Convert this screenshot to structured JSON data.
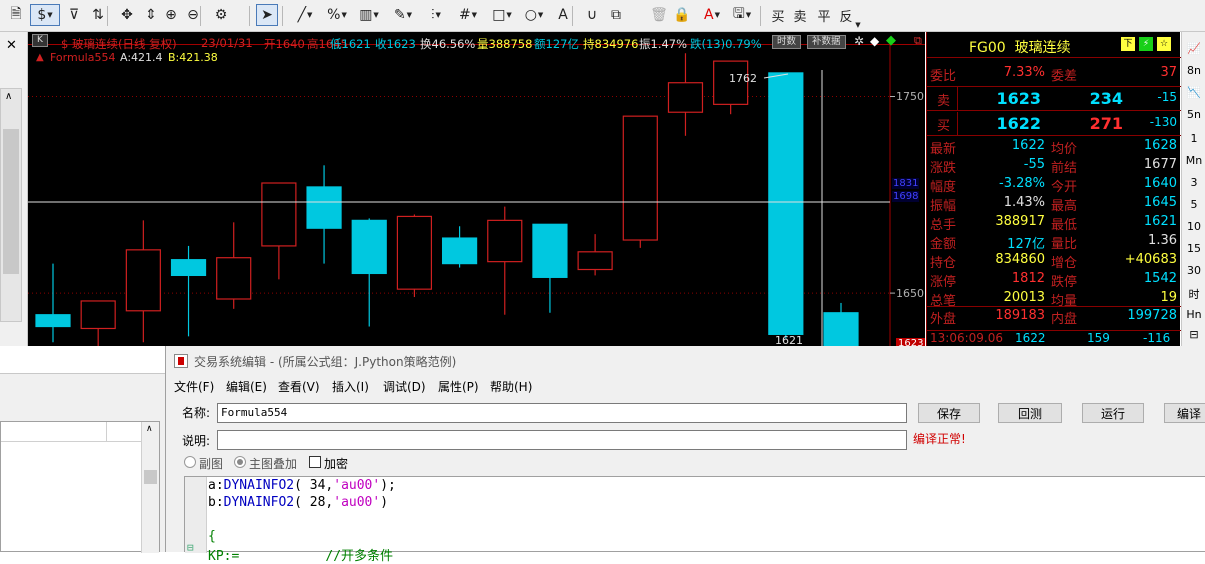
{
  "toolbar": {
    "items": [
      {
        "name": "document-icon",
        "glyph": "🗎"
      },
      {
        "name": "currency-icon",
        "glyph": "$"
      },
      {
        "name": "filter-icon",
        "glyph": "⊽"
      },
      {
        "name": "refresh-icon",
        "glyph": "⇅"
      },
      {
        "name": "move-icon",
        "glyph": "✥"
      },
      {
        "name": "vertical-cursor-icon",
        "glyph": "⇕"
      },
      {
        "name": "zoom-in-icon",
        "glyph": "⊕"
      },
      {
        "name": "zoom-out-icon",
        "glyph": "⊖"
      },
      {
        "name": "settings-icon",
        "glyph": "⚙"
      },
      {
        "name": "pointer-icon",
        "glyph": "➤"
      },
      {
        "name": "line-draw-icon",
        "glyph": "╱"
      },
      {
        "name": "percent-icon",
        "glyph": "%"
      },
      {
        "name": "ruler-icon",
        "glyph": "▥"
      },
      {
        "name": "pen-icon",
        "glyph": "✎"
      },
      {
        "name": "bars-icon",
        "glyph": "⫶"
      },
      {
        "name": "grid-icon",
        "glyph": "#"
      },
      {
        "name": "rectangle-icon",
        "glyph": "□"
      },
      {
        "name": "ellipse-icon",
        "glyph": "○"
      },
      {
        "name": "text-icon",
        "glyph": "A"
      },
      {
        "name": "magnet-icon",
        "glyph": "∪"
      },
      {
        "name": "copy-icon",
        "glyph": "⧉"
      },
      {
        "name": "delete-icon",
        "glyph": "🗑"
      },
      {
        "name": "lock-icon",
        "glyph": "🔒"
      },
      {
        "name": "font-color-icon",
        "glyph": "A"
      },
      {
        "name": "save-icon",
        "glyph": "🖫"
      }
    ],
    "trade_buttons": [
      "买",
      "卖",
      "平",
      "反"
    ]
  },
  "chart": {
    "header": {
      "title": "$ 玻璃连续(日线 复权)",
      "date": "23/01/31",
      "open": "开1640",
      "high": "高1645",
      "low": "低1621",
      "close": "收1623",
      "turnover": "换46.56%",
      "volume": "量388758",
      "amount": "额127亿",
      "oi": "持834976",
      "amplitude": "振1.47%",
      "change": "跌(13)0.79%",
      "btn_period": "时数",
      "btn_fill": "补数据"
    },
    "formula_line": {
      "name": "Formula554",
      "a": "A:421.4",
      "b": "B:421.38"
    },
    "price_labels": {
      "p1750": "1750",
      "p1650": "1650",
      "cross_hi": "1831",
      "cross_lo": "1698",
      "bottom": "1623",
      "high_marker": "1762",
      "low_marker": "1621"
    },
    "colors": {
      "bg": "#000000",
      "up": "#d02020",
      "down": "#00c8e0",
      "grid": "#8b0000",
      "axis": "#b0b0b0"
    }
  },
  "chart_data": {
    "type": "candlestick",
    "ylim": [
      1617,
      1780
    ],
    "ticks": [
      1650,
      1750
    ],
    "candles": [
      {
        "o": 1639,
        "h": 1665,
        "l": 1625,
        "c": 1633,
        "dir": "down"
      },
      {
        "o": 1632,
        "h": 1642,
        "l": 1622,
        "c": 1646,
        "dir": "up"
      },
      {
        "o": 1641,
        "h": 1687,
        "l": 1625,
        "c": 1672,
        "dir": "up"
      },
      {
        "o": 1667,
        "h": 1674,
        "l": 1628,
        "c": 1659,
        "dir": "down"
      },
      {
        "o": 1647,
        "h": 1686,
        "l": 1642,
        "c": 1668,
        "dir": "up"
      },
      {
        "o": 1674,
        "h": 1699,
        "l": 1657,
        "c": 1706,
        "dir": "up"
      },
      {
        "o": 1704,
        "h": 1715,
        "l": 1665,
        "c": 1683,
        "dir": "down"
      },
      {
        "o": 1687,
        "h": 1688,
        "l": 1633,
        "c": 1660,
        "dir": "down"
      },
      {
        "o": 1652,
        "h": 1690,
        "l": 1648,
        "c": 1689,
        "dir": "up"
      },
      {
        "o": 1678,
        "h": 1684,
        "l": 1663,
        "c": 1665,
        "dir": "down"
      },
      {
        "o": 1666,
        "h": 1694,
        "l": 1639,
        "c": 1687,
        "dir": "up"
      },
      {
        "o": 1685,
        "h": 1685,
        "l": 1640,
        "c": 1658,
        "dir": "down"
      },
      {
        "o": 1662,
        "h": 1680,
        "l": 1659,
        "c": 1671,
        "dir": "up"
      },
      {
        "o": 1677,
        "h": 1727,
        "l": 1673,
        "c": 1740,
        "dir": "up"
      },
      {
        "o": 1742,
        "h": 1772,
        "l": 1730,
        "c": 1757,
        "dir": "up"
      },
      {
        "o": 1746,
        "h": 1760,
        "l": 1741,
        "c": 1768,
        "dir": "up"
      },
      {
        "o": 1762,
        "h": 1762,
        "l": 1627,
        "c": 1629,
        "dir": "down"
      },
      {
        "o": 1640,
        "h": 1645,
        "l": 1621,
        "c": 1623,
        "dir": "down"
      }
    ]
  },
  "quote": {
    "title": "FG00  玻璃连续",
    "rows": [
      {
        "l1": "委比",
        "v1": "7.33%",
        "l2": "委差",
        "v2": "37",
        "c1": "#ff3030",
        "c2": "#ff3030"
      },
      {
        "l1": "卖",
        "v1": "1623",
        "l2": "",
        "v2": "234",
        "v3": "-15",
        "c1": "#00e0ff",
        "c2": "#00e0ff"
      },
      {
        "l1": "买",
        "v1": "1622",
        "l2": "",
        "v2": "271",
        "v3": "-130",
        "c1": "#00e0ff",
        "c2": "#ff3030"
      },
      {
        "l1": "最新",
        "v1": "1622",
        "l2": "均价",
        "v2": "1628",
        "c1": "#00e0ff",
        "c2": "#00e0ff"
      },
      {
        "l1": "涨跌",
        "v1": "-55",
        "l2": "前结",
        "v2": "1677",
        "c1": "#00e0ff",
        "c2": "#e0e0e0"
      },
      {
        "l1": "幅度",
        "v1": "-3.28%",
        "l2": "今开",
        "v2": "1640",
        "c1": "#00e0ff",
        "c2": "#00e0ff"
      },
      {
        "l1": "振幅",
        "v1": "1.43%",
        "l2": "最高",
        "v2": "1645",
        "c1": "#e0e0e0",
        "c2": "#00e0ff"
      },
      {
        "l1": "总手",
        "v1": "388917",
        "l2": "最低",
        "v2": "1621",
        "c1": "#ffff40",
        "c2": "#00e0ff"
      },
      {
        "l1": "金额",
        "v1": "127亿",
        "l2": "量比",
        "v2": "1.36",
        "c1": "#00e0ff",
        "c2": "#e0e0e0"
      },
      {
        "l1": "持仓",
        "v1": "834860",
        "l2": "增仓",
        "v2": "+40683",
        "c1": "#ffff40",
        "c2": "#ffff40"
      },
      {
        "l1": "涨停",
        "v1": "1812",
        "l2": "跌停",
        "v2": "1542",
        "c1": "#ff3030",
        "c2": "#00e0ff"
      },
      {
        "l1": "总笔",
        "v1": "20013",
        "l2": "均量",
        "v2": "19",
        "c1": "#ffff40",
        "c2": "#ffff40"
      },
      {
        "l1": "外盘",
        "v1": "189183",
        "l2": "内盘",
        "v2": "199728",
        "c1": "#ff3030",
        "c2": "#00e0ff"
      }
    ],
    "tick": {
      "time": "13:06:09.06",
      "price": "1622",
      "vol": "159",
      "chg": "-116"
    }
  },
  "right_periods": [
    "📈",
    "8n",
    "📉",
    "5n",
    "1",
    "Mn",
    "3",
    "5",
    "10",
    "15",
    "30",
    "时",
    "Hn",
    "⊟"
  ],
  "editor": {
    "title": "交易系统编辑 - (所属公式组：J.Python策略范例)",
    "menus": [
      "文件(F)",
      "编辑(E)",
      "查看(V)",
      "插入(I)",
      "调试(D)",
      "属性(P)",
      "帮助(H)"
    ],
    "name_label": "名称:",
    "name_value": "Formula554",
    "desc_label": "说明:",
    "desc_value": "",
    "buttons": {
      "save": "保存",
      "restore": "回测",
      "run": "运行",
      "compile": "编译"
    },
    "status": "编译正常!",
    "radio_sub": "副图",
    "radio_main": "主图叠加",
    "check_encrypt": "加密",
    "code_lines": [
      "a:DYNAINFO2( 34,'au00');",
      "b:DYNAINFO2( 28,'au00')",
      "",
      "{",
      "KP:=           //开多条件"
    ]
  }
}
